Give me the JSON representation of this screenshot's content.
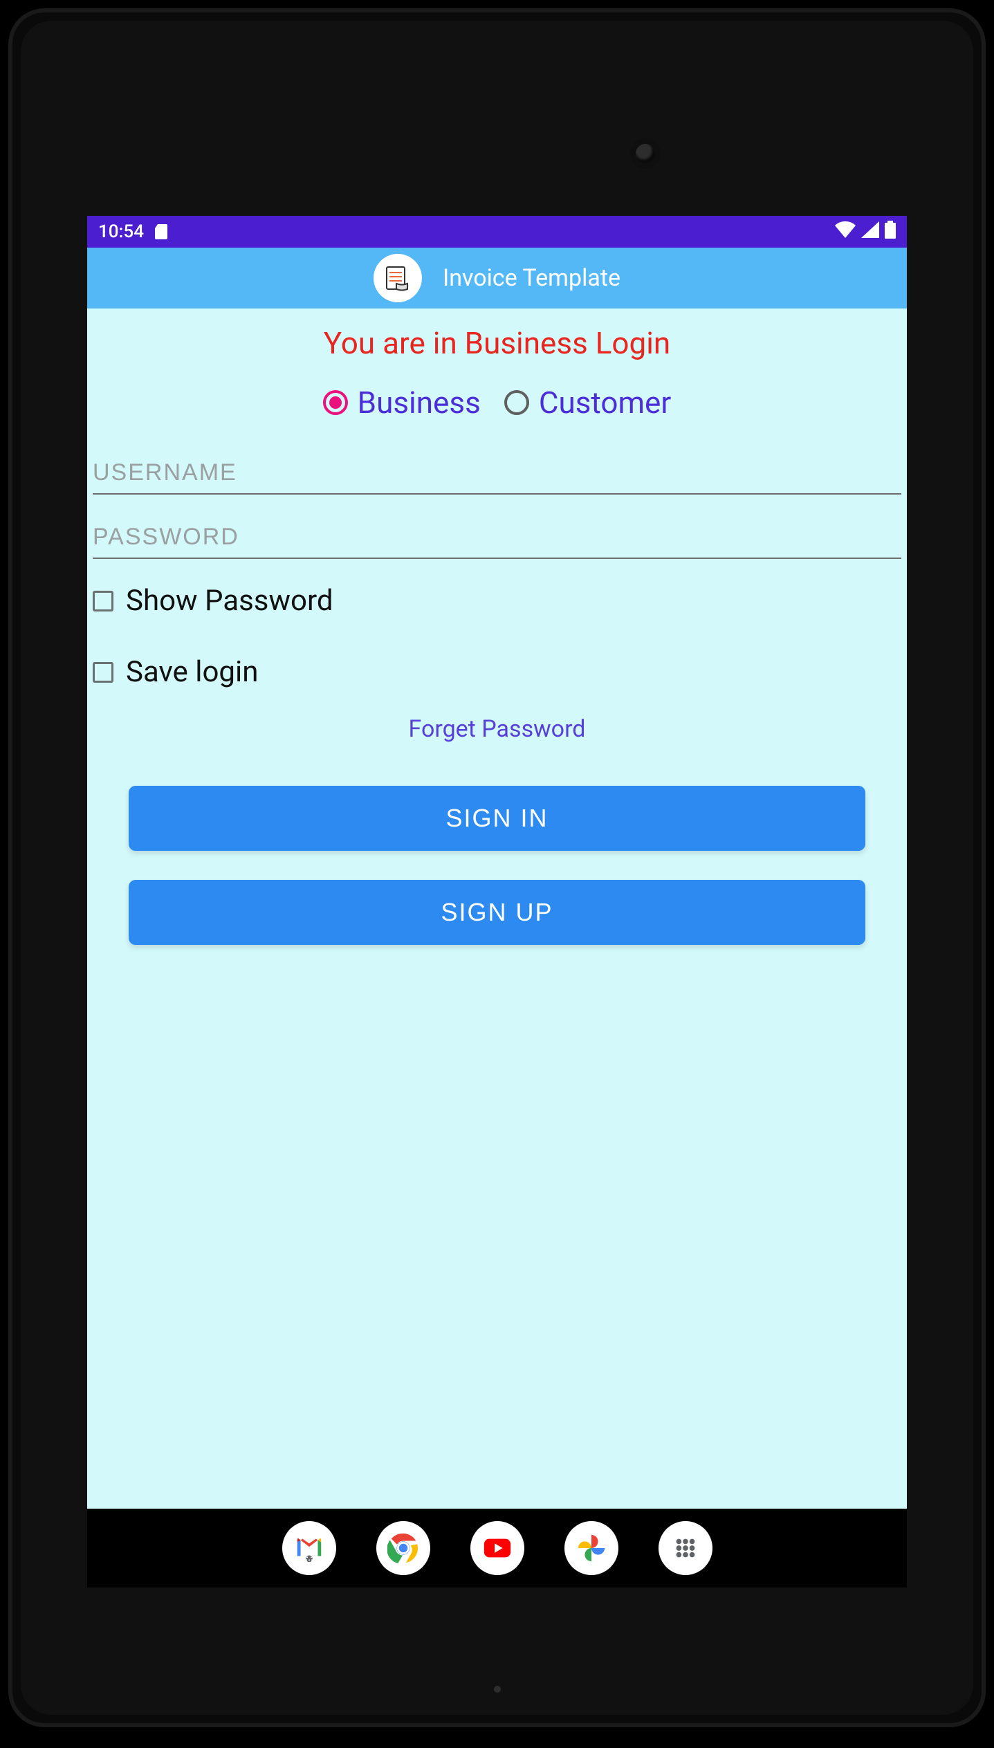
{
  "statusbar": {
    "time": "10:54"
  },
  "appbar": {
    "title": "Invoice Template"
  },
  "login": {
    "heading": "You are in Business Login",
    "radios": {
      "business": {
        "label": "Business",
        "selected": true
      },
      "customer": {
        "label": "Customer",
        "selected": false
      }
    },
    "username": {
      "value": "",
      "placeholder": "USERNAME"
    },
    "password": {
      "value": "",
      "placeholder": "PASSWORD"
    },
    "show_password": {
      "label": "Show Password",
      "checked": false
    },
    "save_login": {
      "label": "Save login",
      "checked": false
    },
    "forget_label": "Forget Password",
    "signin_label": "SIGN IN",
    "signup_label": "SIGN UP"
  }
}
